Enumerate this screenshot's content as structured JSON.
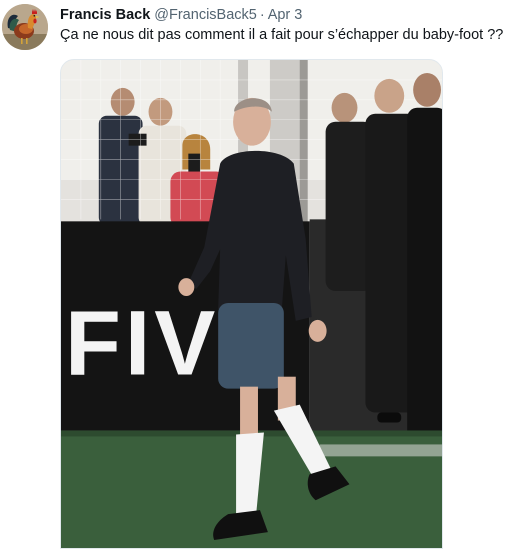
{
  "tweet": {
    "author": {
      "display_name": "Francis Back",
      "handle": "@FrancisBack5",
      "avatar_icon": "rooster-avatar"
    },
    "separator": "·",
    "date": "Apr 3",
    "text": "Ça ne nous dit pas comment il a fait pour s’échapper du baby-foot ??",
    "media": {
      "banner_text": "FIVE"
    }
  },
  "colors": {
    "text_primary": "#0f1419",
    "text_secondary": "#536471",
    "turf": "#3a5f3c"
  }
}
